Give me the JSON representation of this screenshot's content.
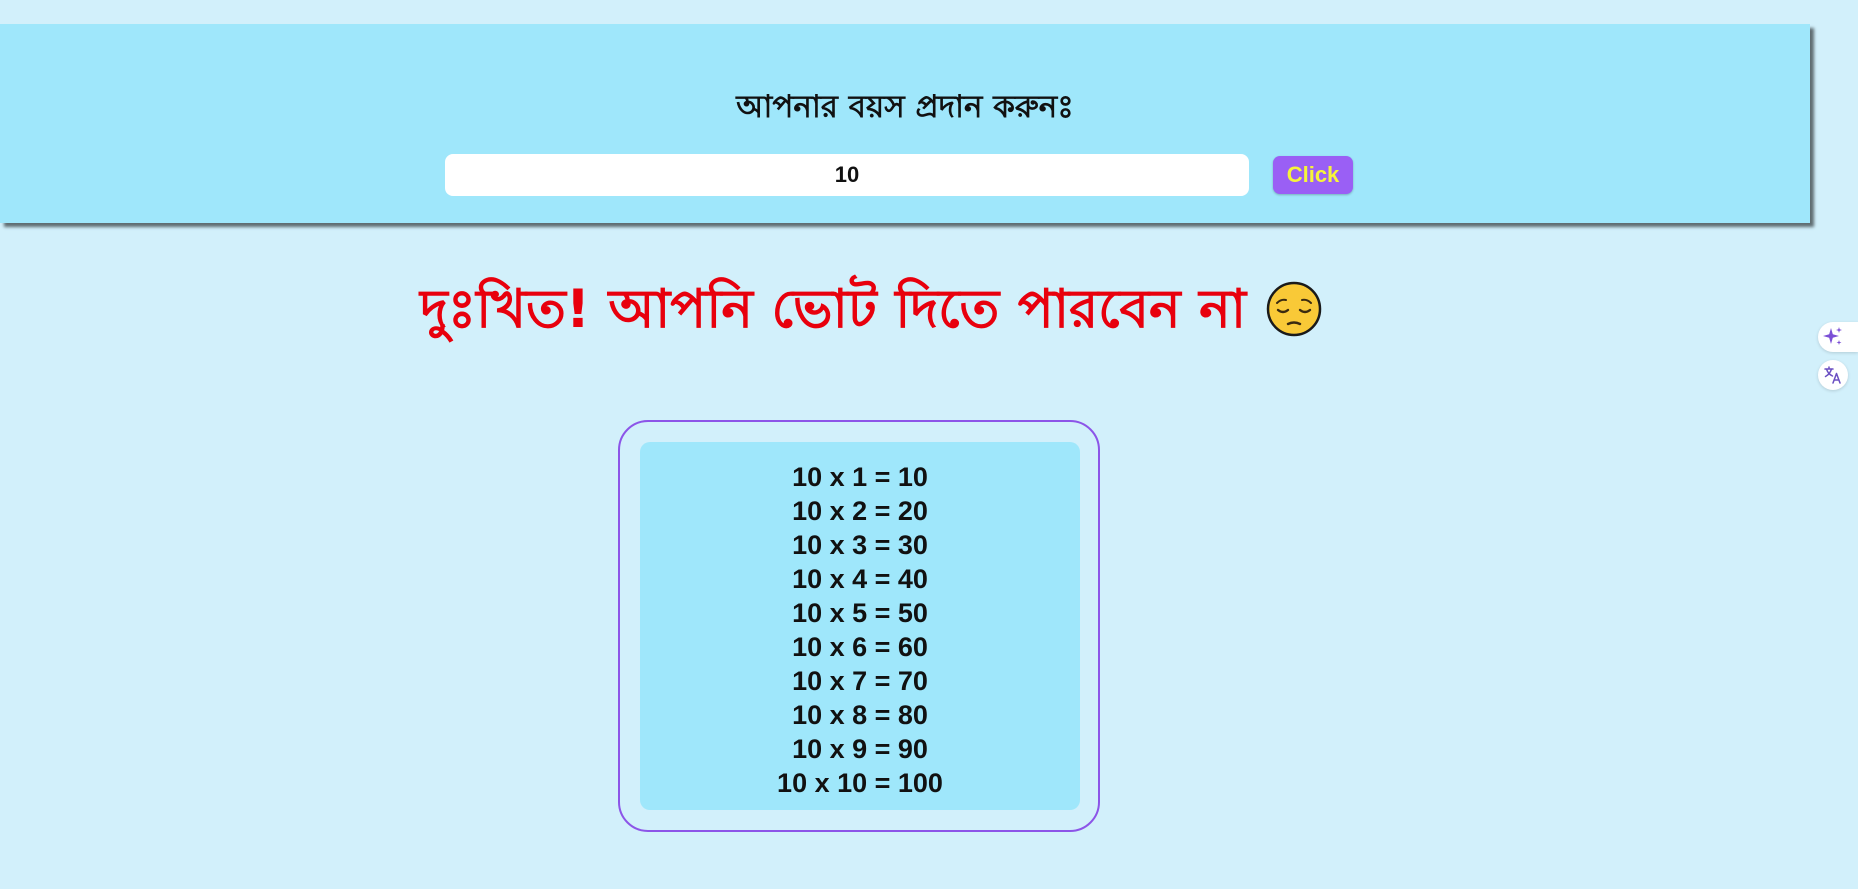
{
  "form": {
    "label": "আপনার বয়স প্রদান করুনঃ",
    "age_value": "10",
    "button_label": "Click"
  },
  "result": {
    "message": "দুঃখিত! আপনি ভোট দিতে পারবেন না",
    "emoji": "pensive-face-icon"
  },
  "multiplication_table": [
    "10 x 1 = 10",
    "10 x 2 = 20",
    "10 x 3 = 30",
    "10 x 4 = 40",
    "10 x 5 = 50",
    "10 x 6 = 60",
    "10 x 7 = 70",
    "10 x 8 = 80",
    "10 x 9 = 90",
    "10 x 10 = 100"
  ],
  "side_tools": {
    "icons": [
      "sparkle-icon",
      "translate-icon"
    ]
  },
  "colors": {
    "page_background": "#d2f0fb",
    "panel_background": "#9fe7fb",
    "message_color": "#e8000d",
    "button_background": "#9a5ff5",
    "button_text": "#f6f43a",
    "frame_border": "#8c55e8"
  }
}
